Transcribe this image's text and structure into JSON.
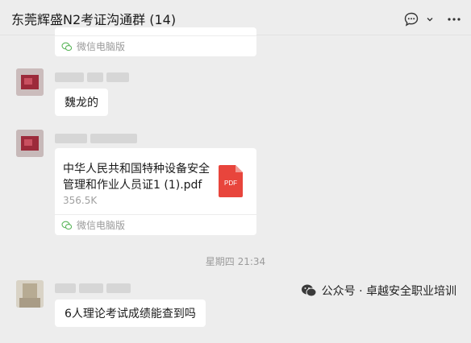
{
  "header": {
    "title": "东莞辉盛N2考证沟通群 (14)"
  },
  "messages": {
    "top_card_footer": "微信电脑版",
    "msg1_text": "魏龙的",
    "file": {
      "name": "中华人民共和国特种设备安全管理和作业人员证1 (1).pdf",
      "size": "356.5K",
      "icon_label": "PDF",
      "footer": "微信电脑版"
    },
    "timestamp": "星期四 21:34",
    "msg3_text": "6人理论考试成绩能查到吗"
  },
  "watermark": {
    "text": "公众号 · 卓越安全职业培训"
  },
  "colors": {
    "background": "#ededed",
    "bubble": "#ffffff",
    "pdf_red": "#e8453c"
  }
}
